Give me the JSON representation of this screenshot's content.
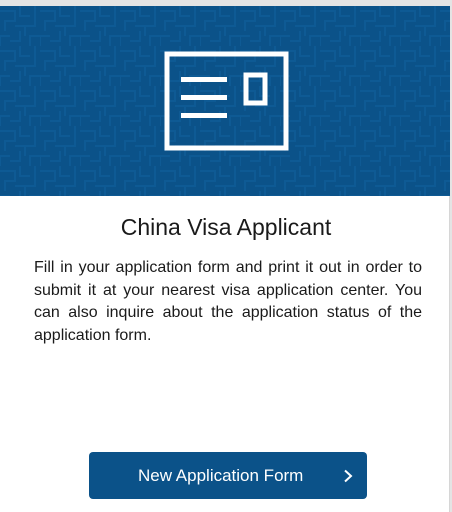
{
  "card": {
    "title": "China Visa Applicant",
    "description": "Fill in your application form and print it out in order to submit it at your nearest visa application center. You can also inquire about the application status of the application form.",
    "icon": "application-form-icon"
  },
  "actions": {
    "new_form_label": "New Application Form",
    "chevron_icon": "chevron-right-icon"
  },
  "colors": {
    "brand_blue": "#0b5289",
    "text": "#1a1a1a",
    "background": "#ffffff"
  }
}
